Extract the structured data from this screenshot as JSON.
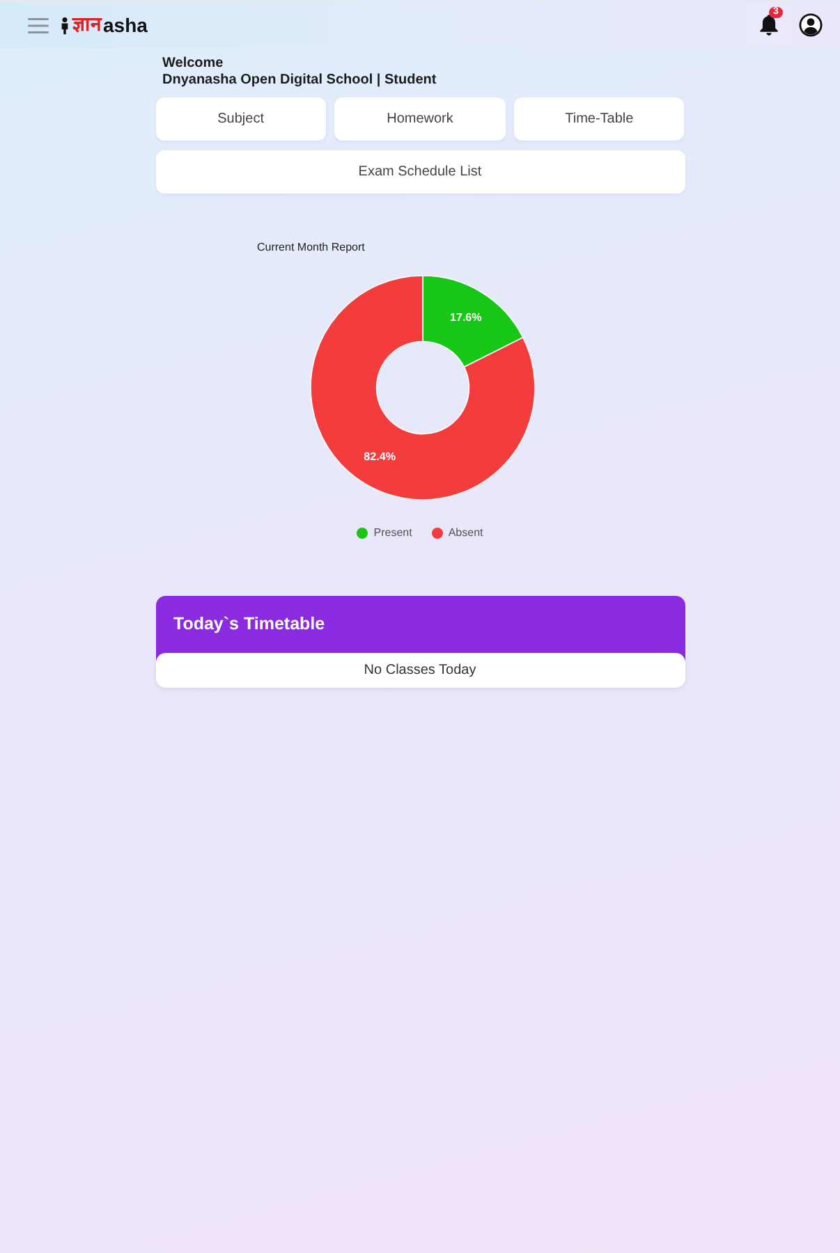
{
  "header": {
    "logo": {
      "mark": "ज्ञान",
      "word": "asha"
    },
    "notifications": {
      "count": "3"
    }
  },
  "welcome": {
    "greeting": "Welcome",
    "school_line": "Dnyanasha Open Digital School | Student"
  },
  "nav_buttons": [
    "Subject",
    "Homework",
    "Time-Table"
  ],
  "wide_buttons": [
    "Exam Schedule List"
  ],
  "attendance": {
    "chart_data": {
      "type": "donut",
      "title": "Current Month Report",
      "categories": [
        "Present",
        "Absent"
      ],
      "values": [
        17.6,
        82.4
      ],
      "colors": [
        "#16c716",
        "#f43c3c"
      ],
      "value_labels": [
        "17.6%",
        "82.4%"
      ],
      "legend": "bottom"
    }
  },
  "timetable": {
    "title": "Today`s Timetable",
    "empty_message": "No Classes Today"
  }
}
